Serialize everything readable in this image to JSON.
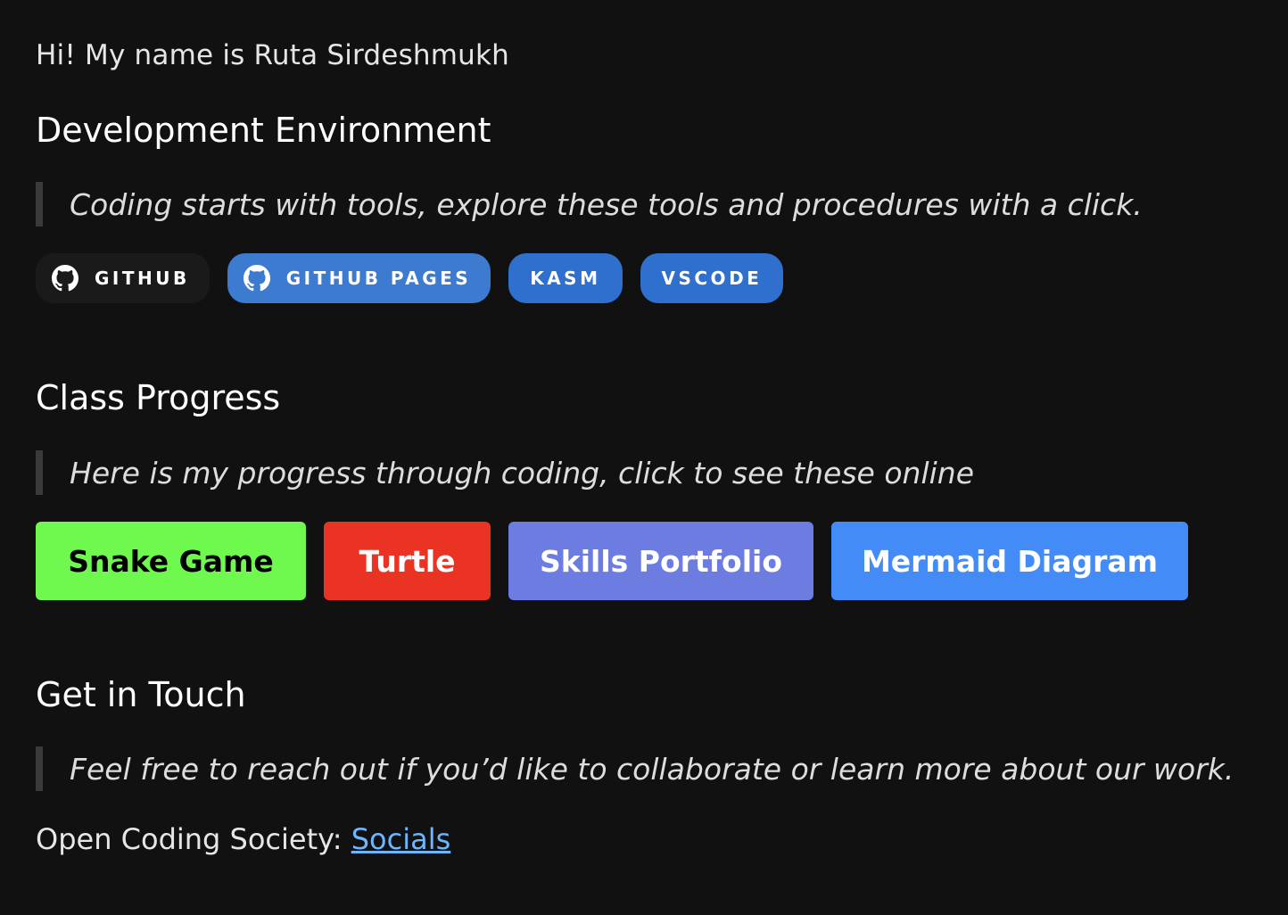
{
  "intro": "Hi! My name is Ruta Sirdeshmukh",
  "dev_env": {
    "title": "Development Environment",
    "quote": "Coding starts with tools, explore these tools and procedures with a click.",
    "badges": [
      {
        "label": "GITHUB",
        "icon": "github-icon",
        "bg": "#1a1a1a"
      },
      {
        "label": "GITHUB PAGES",
        "icon": "github-icon",
        "bg": "#3d7bd0"
      },
      {
        "label": "KASM",
        "bg": "#2f6fcd"
      },
      {
        "label": "VSCODE",
        "bg": "#2f6fcd"
      }
    ]
  },
  "progress": {
    "title": "Class Progress",
    "quote": "Here is my progress through coding, click to see these online",
    "buttons": [
      {
        "label": "Snake Game",
        "bg": "#6ff94f",
        "fg": "#000000"
      },
      {
        "label": "Turtle",
        "bg": "#eb3323",
        "fg": "#ffffff"
      },
      {
        "label": "Skills Portfolio",
        "bg": "#6c7ce0",
        "fg": "#ffffff"
      },
      {
        "label": "Mermaid Diagram",
        "bg": "#438cf8",
        "fg": "#ffffff"
      }
    ]
  },
  "contact": {
    "title": "Get in Touch",
    "quote": "Feel free to reach out if you’d like to collaborate or learn more about our work.",
    "org_label": "Open Coding Society: ",
    "link_label": "Socials",
    "link_color": "#6cb6ff"
  }
}
